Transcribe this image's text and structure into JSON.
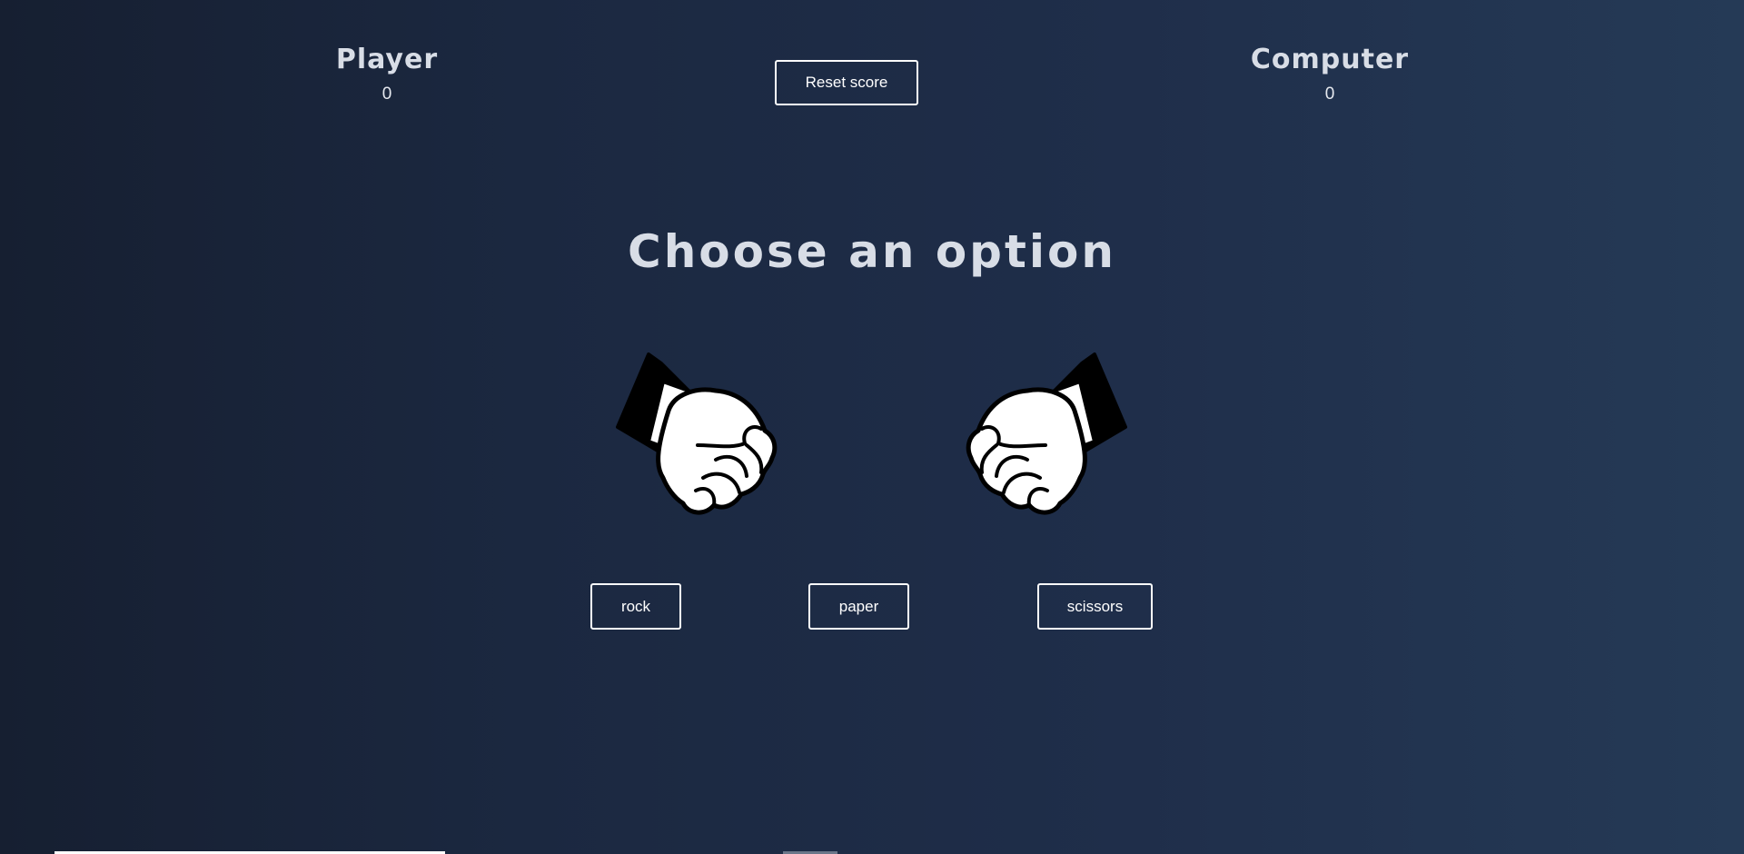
{
  "scoreboard": {
    "player": {
      "label": "Player",
      "score": "0"
    },
    "computer": {
      "label": "Computer",
      "score": "0"
    },
    "reset_label": "Reset score"
  },
  "game": {
    "heading": "Choose an option",
    "player_hand_icon": "fist-icon",
    "computer_hand_icon": "fist-icon",
    "choices": [
      {
        "label": "rock"
      },
      {
        "label": "paper"
      },
      {
        "label": "scissors"
      }
    ]
  },
  "colors": {
    "background_start": "#161f31",
    "background_end": "#253a56",
    "text": "#d8dde6",
    "button_border": "#ffffff"
  }
}
